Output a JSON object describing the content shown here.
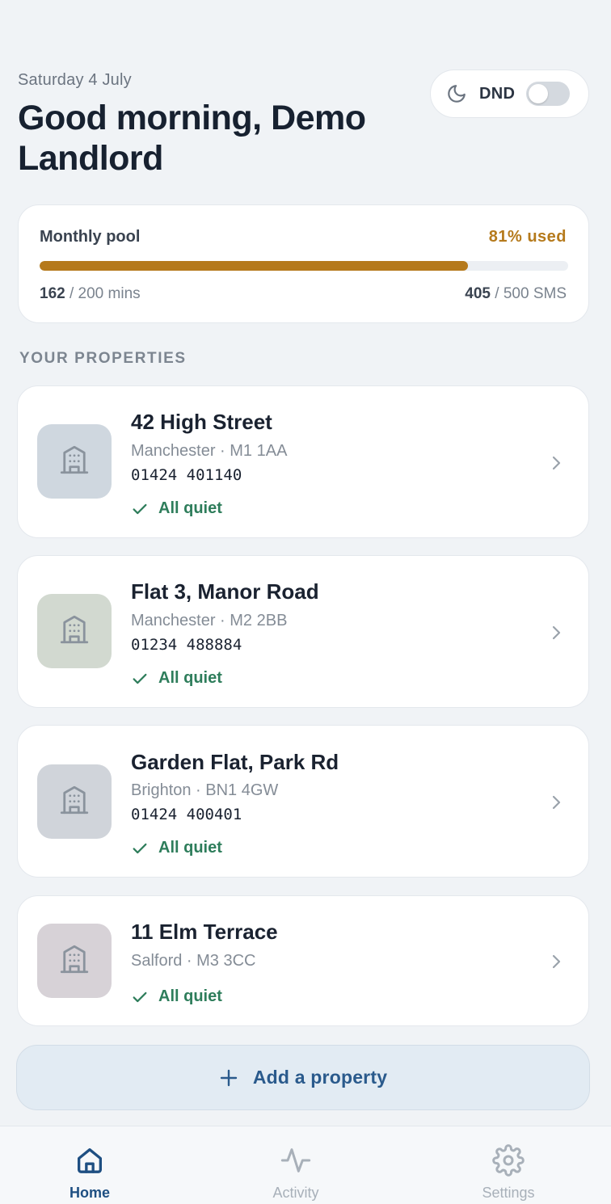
{
  "header": {
    "date": "Saturday 4 July",
    "greeting_line1": "Good morning, Demo",
    "greeting_line2": "Landlord"
  },
  "dnd": {
    "label": "DND",
    "enabled": false
  },
  "pool": {
    "title": "Monthly pool",
    "percent_used": "81%",
    "used_label": "used",
    "fill_fraction": 0.81,
    "mins_used": "162",
    "mins_total": "/ 200 mins",
    "sms_used": "405",
    "sms_total": "/ 500 SMS",
    "accent_color": "#b5791c"
  },
  "section_title": "YOUR PROPERTIES",
  "properties": [
    {
      "name": "42 High Street",
      "location": "Manchester · M1 1AA",
      "phone": "01424 401140",
      "status": "All quiet",
      "thumb_color": "#cfd7df"
    },
    {
      "name": "Flat 3, Manor Road",
      "location": "Manchester · M2 2BB",
      "phone": "01234 488884",
      "status": "All quiet",
      "thumb_color": "#d2d9d0"
    },
    {
      "name": "Garden Flat, Park Rd",
      "location": "Brighton · BN1 4GW",
      "phone": "01424 400401",
      "status": "All quiet",
      "thumb_color": "#d0d4da"
    },
    {
      "name": "11 Elm Terrace",
      "location": "Salford · M3 3CC",
      "phone": "",
      "status": "All quiet",
      "thumb_color": "#d7d2d7"
    }
  ],
  "add_property": {
    "label": "Add a property"
  },
  "tabs": [
    {
      "label": "Home",
      "icon": "home-icon",
      "active": true
    },
    {
      "label": "Activity",
      "icon": "activity-icon",
      "active": false
    },
    {
      "label": "Settings",
      "icon": "gear-icon",
      "active": false
    }
  ],
  "status_color": "#2e7d5b",
  "brand_color": "#1e4f82"
}
